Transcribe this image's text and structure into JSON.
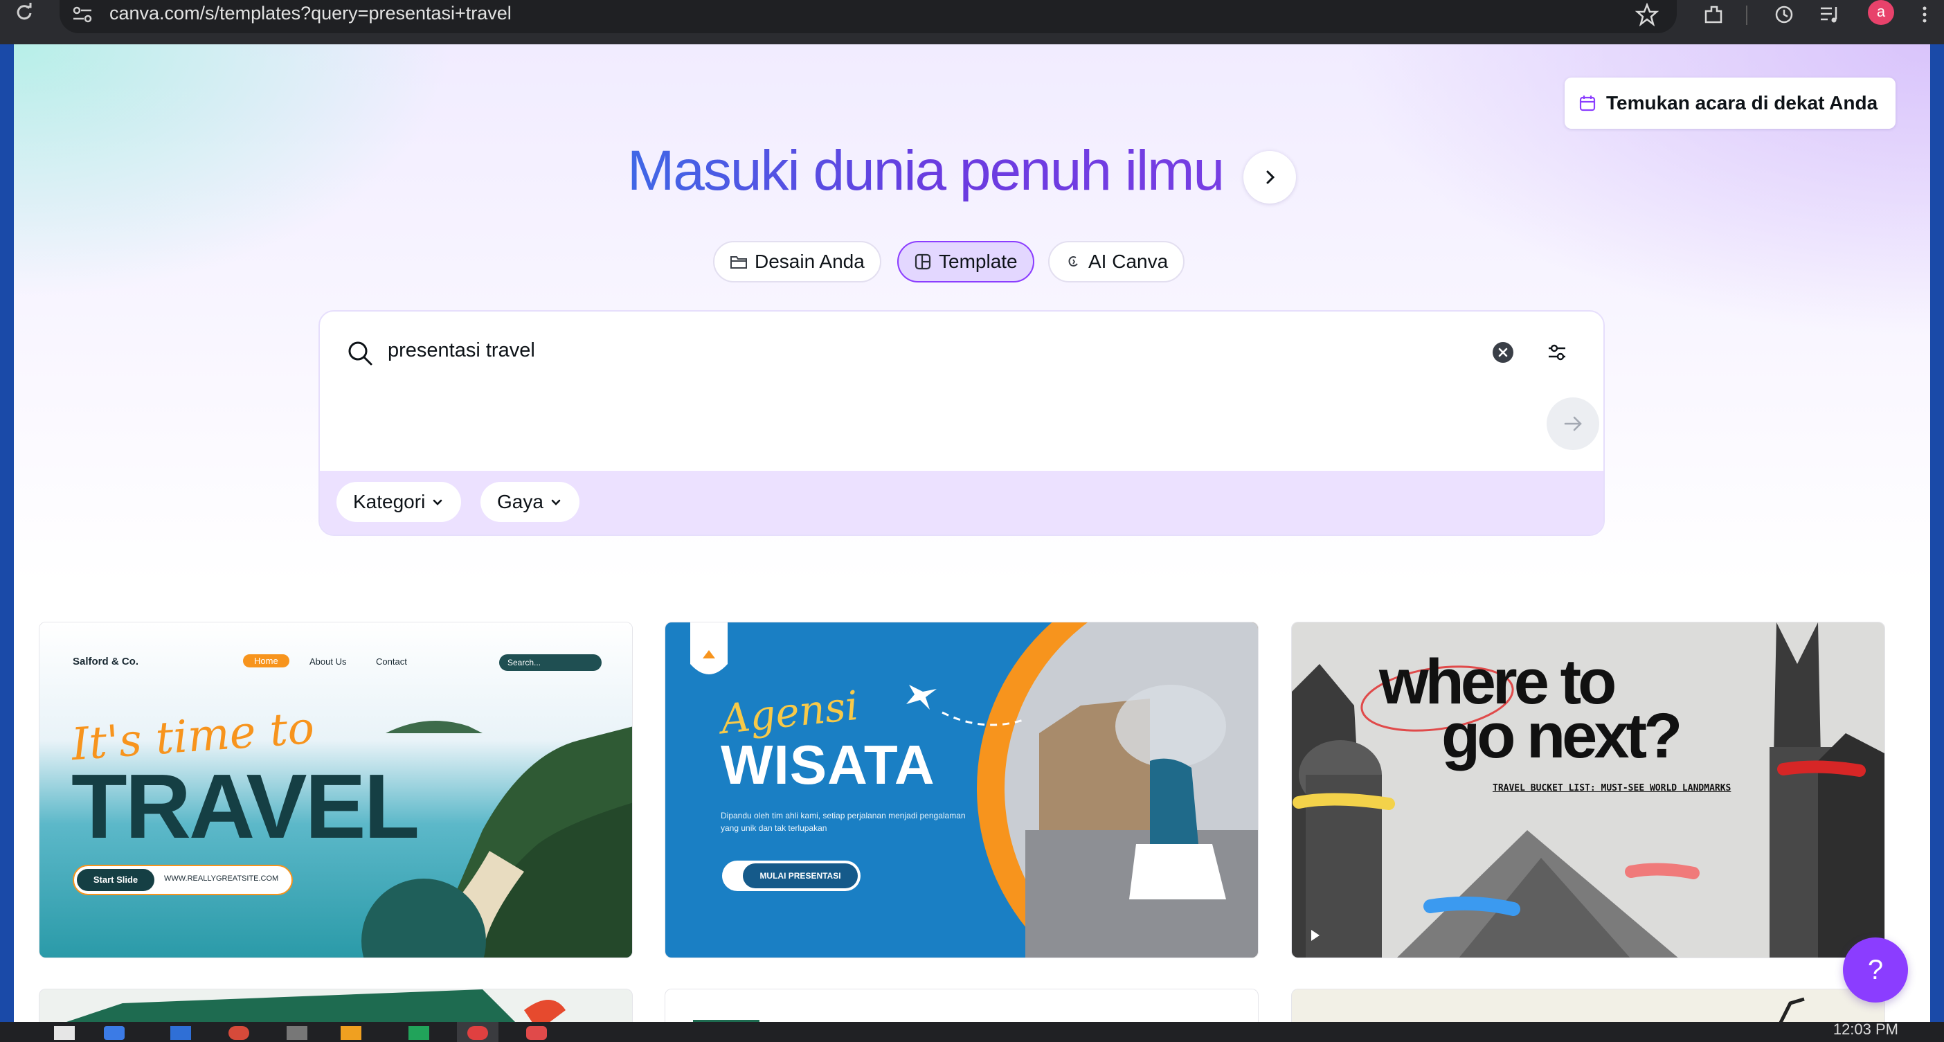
{
  "browser": {
    "url": "canva.com/s/templates?query=presentasi+travel",
    "profile_initial": "a",
    "clock": "12:03 PM"
  },
  "header": {
    "event_button": "Temukan acara di dekat Anda",
    "headline": "Masuki dunia penuh ilmu"
  },
  "tabs": [
    {
      "label": "Desain Anda",
      "icon": "folder-icon",
      "active": false
    },
    {
      "label": "Template",
      "icon": "template-icon",
      "active": true
    },
    {
      "label": "AI Canva",
      "icon": "canva-ai-icon",
      "active": false
    }
  ],
  "search": {
    "value": "presentasi travel",
    "filters": [
      {
        "label": "Kategori"
      },
      {
        "label": "Gaya"
      }
    ]
  },
  "cards": [
    {
      "brand": "Salford & Co.",
      "nav": [
        "Home",
        "About Us",
        "Contact"
      ],
      "search_placeholder": "Search...",
      "script_title": "It's time to",
      "big_title": "TRAVEL",
      "button": "Start Slide",
      "website": "WWW.REALLYGREATSITE.COM"
    },
    {
      "script_title": "Agensi",
      "big_title": "WISATA",
      "body": "Dipandu oleh tim ahli kami, setiap perjalanan menjadi pengalaman yang unik dan tak terlupakan",
      "button": "MULAI PRESENTASI"
    },
    {
      "big_title_1": "where to",
      "big_title_2": "go next?",
      "subtitle": "TRAVEL BUCKET LIST: MUST-SEE WORLD LANDMARKS"
    }
  ],
  "help": {
    "label": "?"
  },
  "colors": {
    "brand_purple": "#8b3dff",
    "headline_start": "#3f68e6",
    "headline_end": "#7b3fe4",
    "filter_bar": "#ece1ff"
  }
}
